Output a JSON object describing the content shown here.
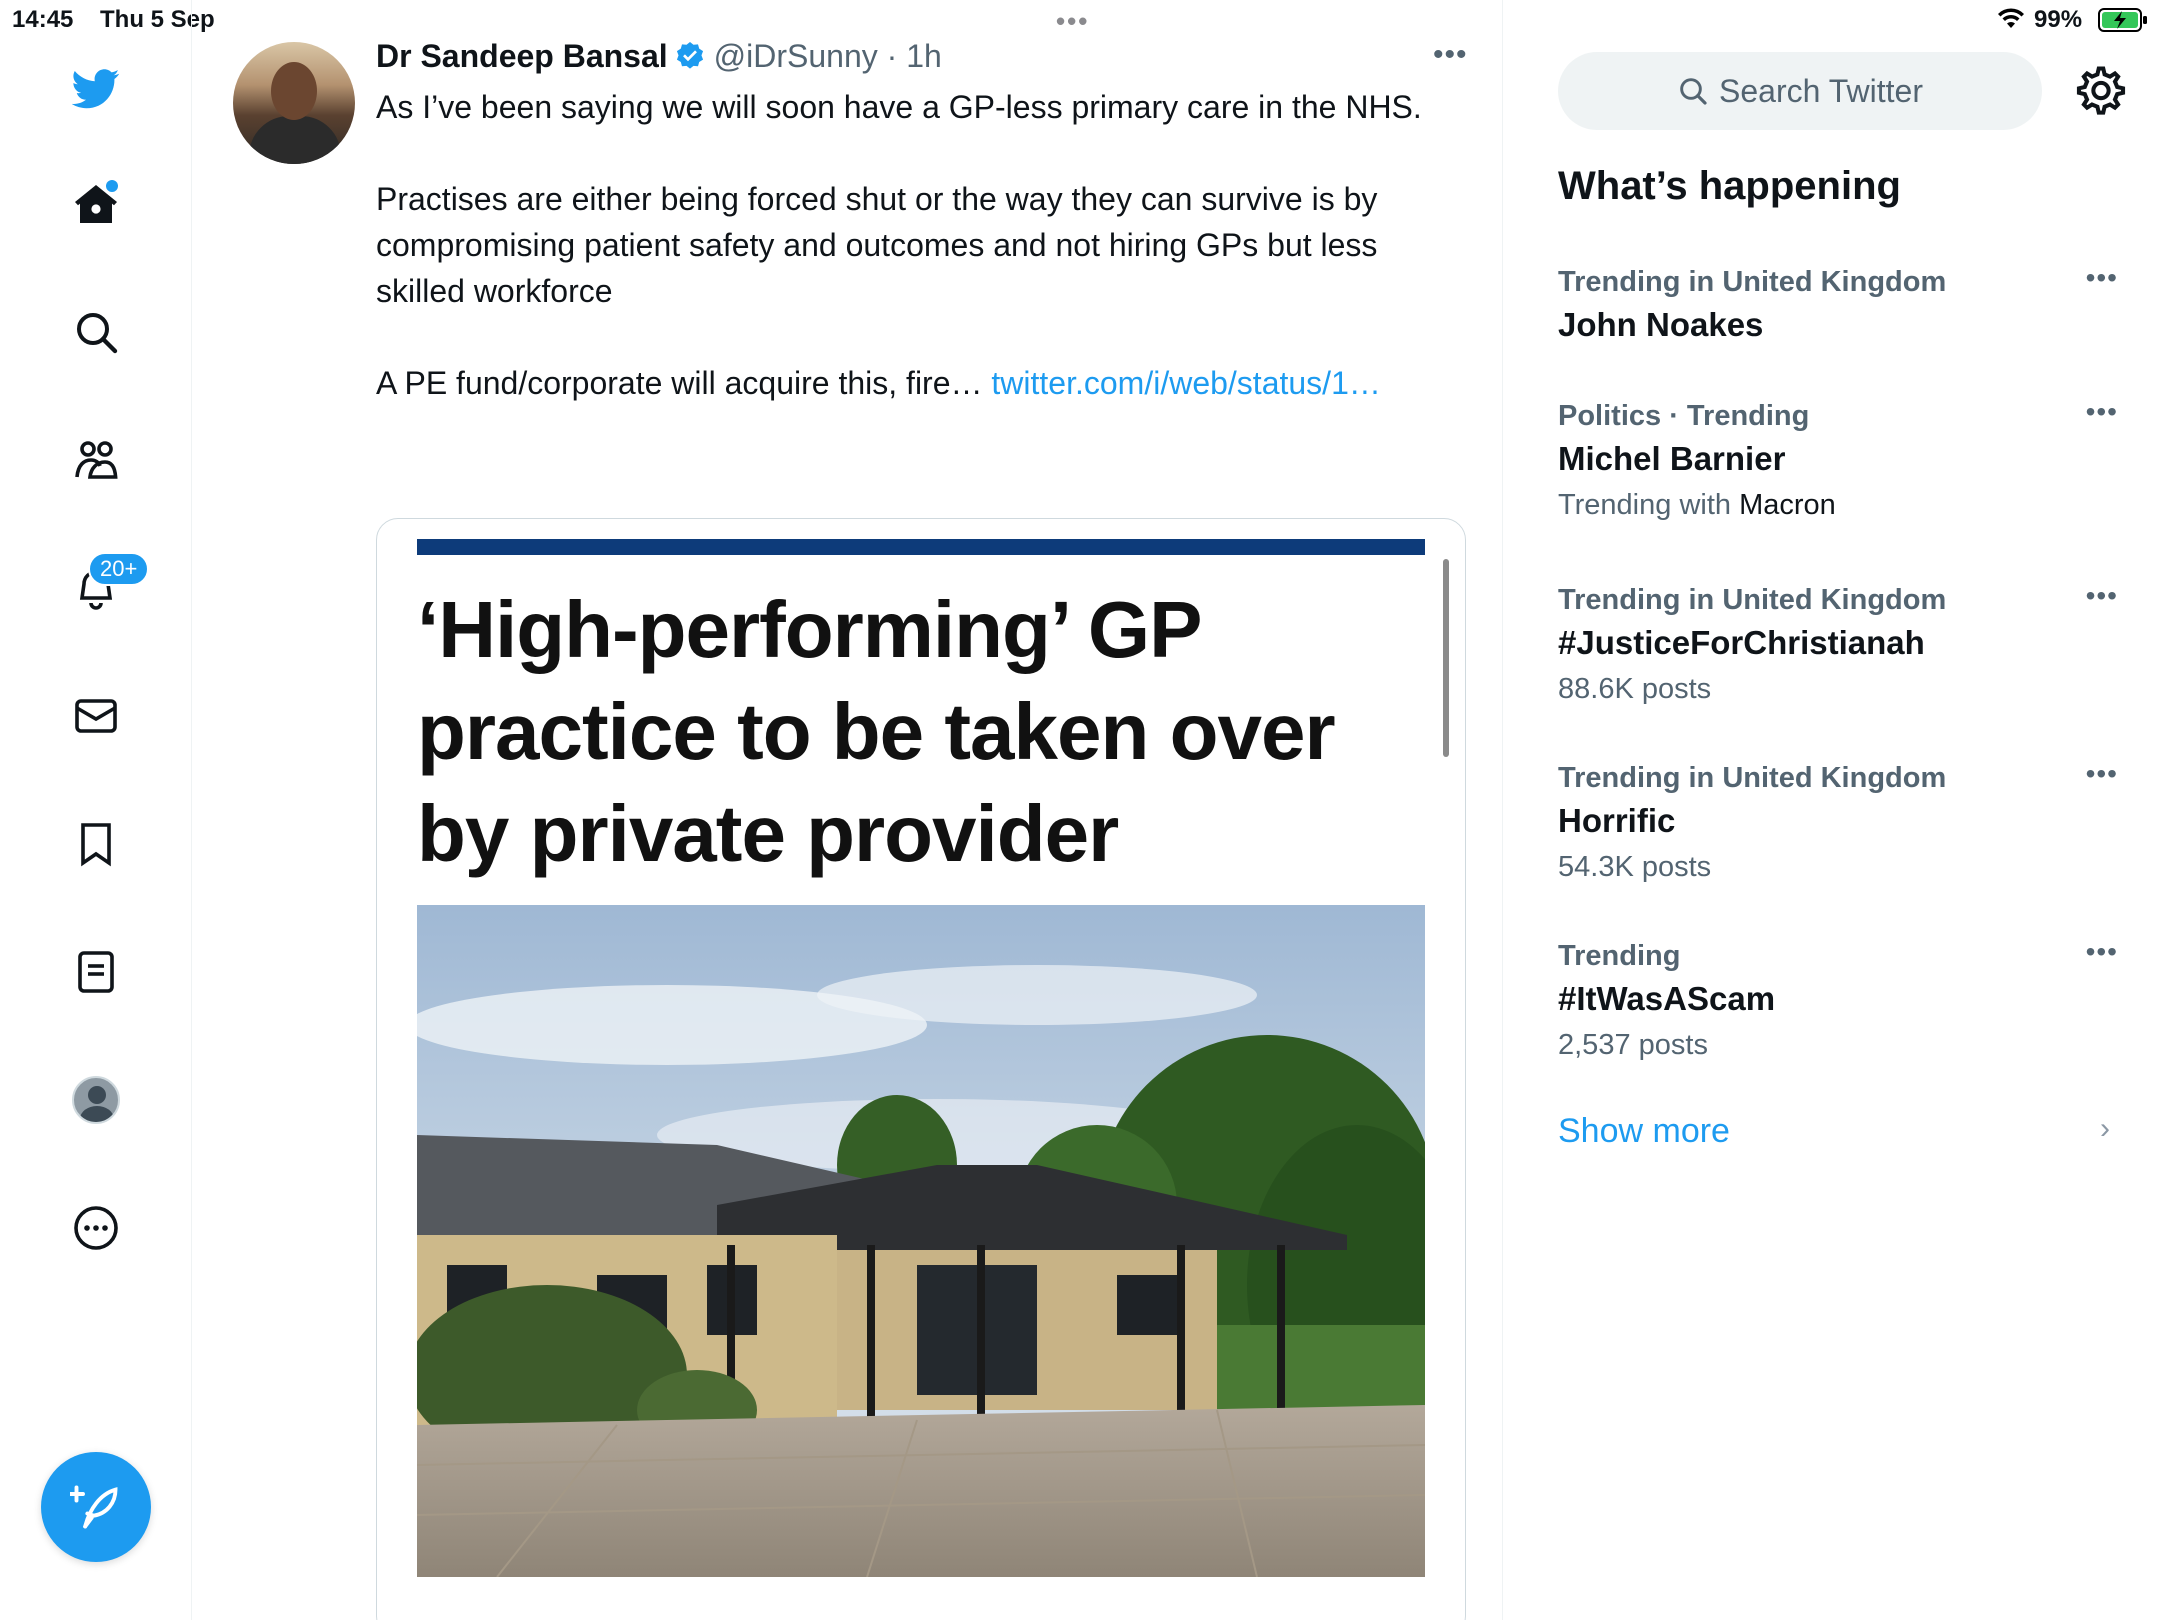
{
  "status_bar": {
    "time": "14:45",
    "date": "Thu 5 Sep",
    "battery": "99%"
  },
  "nav": {
    "notifications_badge": "20+",
    "icons": [
      "twitter-logo-icon",
      "home-icon",
      "search-icon",
      "communities-icon",
      "notifications-icon",
      "messages-icon",
      "bookmarks-icon",
      "lists-icon",
      "profile-icon",
      "more-icon",
      "compose-icon"
    ]
  },
  "tweet": {
    "author": "Dr Sandeep Bansal",
    "handle": "@iDrSunny",
    "time": "1h",
    "paragraph1": "As I’ve been saying we will soon have a GP-less primary care in the NHS.",
    "paragraph2": "Practises are either being forced shut or the way they can survive is by compromising patient safety and outcomes and not hiring GPs but less skilled workforce",
    "paragraph3": "A PE fund/corporate will acquire this, fire… ",
    "link": "twitter.com/i/web/status/1…",
    "media_headline": "‘High-performing’ GP practice to be taken over by private provider"
  },
  "sidebar": {
    "search_placeholder": "Search Twitter",
    "section_title": "What’s happening",
    "trends": [
      {
        "context": "Trending in United Kingdom",
        "name": "John Noakes",
        "meta": ""
      },
      {
        "context": "Politics · Trending",
        "name": "Michel Barnier",
        "meta_prefix": "Trending with ",
        "meta_bold": "Macron"
      },
      {
        "context": "Trending in United Kingdom",
        "name": "#JusticeForChristianah",
        "meta": "88.6K posts"
      },
      {
        "context": "Trending in United Kingdom",
        "name": "Horrific",
        "meta": "54.3K posts"
      },
      {
        "context": "Trending",
        "name": "#ItWasAScam",
        "meta": "2,537 posts"
      }
    ],
    "show_more": "Show more"
  },
  "colors": {
    "accent": "#1d9bf0",
    "text_primary": "#0f1419",
    "text_secondary": "#536471",
    "media_bar": "#0d3b7a"
  }
}
